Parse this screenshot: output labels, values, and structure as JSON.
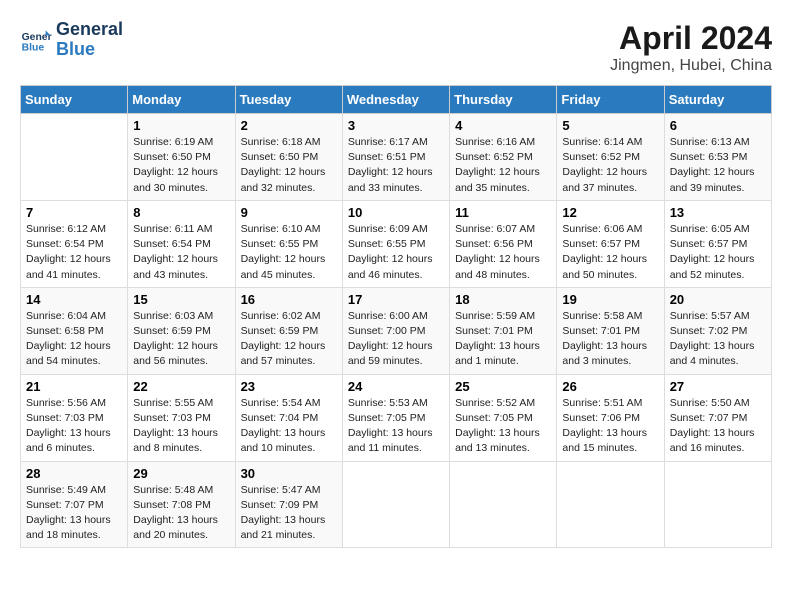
{
  "header": {
    "logo_line1": "General",
    "logo_line2": "Blue",
    "title": "April 2024",
    "subtitle": "Jingmen, Hubei, China"
  },
  "days_of_week": [
    "Sunday",
    "Monday",
    "Tuesday",
    "Wednesday",
    "Thursday",
    "Friday",
    "Saturday"
  ],
  "weeks": [
    [
      {
        "num": "",
        "info": ""
      },
      {
        "num": "1",
        "info": "Sunrise: 6:19 AM\nSunset: 6:50 PM\nDaylight: 12 hours\nand 30 minutes."
      },
      {
        "num": "2",
        "info": "Sunrise: 6:18 AM\nSunset: 6:50 PM\nDaylight: 12 hours\nand 32 minutes."
      },
      {
        "num": "3",
        "info": "Sunrise: 6:17 AM\nSunset: 6:51 PM\nDaylight: 12 hours\nand 33 minutes."
      },
      {
        "num": "4",
        "info": "Sunrise: 6:16 AM\nSunset: 6:52 PM\nDaylight: 12 hours\nand 35 minutes."
      },
      {
        "num": "5",
        "info": "Sunrise: 6:14 AM\nSunset: 6:52 PM\nDaylight: 12 hours\nand 37 minutes."
      },
      {
        "num": "6",
        "info": "Sunrise: 6:13 AM\nSunset: 6:53 PM\nDaylight: 12 hours\nand 39 minutes."
      }
    ],
    [
      {
        "num": "7",
        "info": "Sunrise: 6:12 AM\nSunset: 6:54 PM\nDaylight: 12 hours\nand 41 minutes."
      },
      {
        "num": "8",
        "info": "Sunrise: 6:11 AM\nSunset: 6:54 PM\nDaylight: 12 hours\nand 43 minutes."
      },
      {
        "num": "9",
        "info": "Sunrise: 6:10 AM\nSunset: 6:55 PM\nDaylight: 12 hours\nand 45 minutes."
      },
      {
        "num": "10",
        "info": "Sunrise: 6:09 AM\nSunset: 6:55 PM\nDaylight: 12 hours\nand 46 minutes."
      },
      {
        "num": "11",
        "info": "Sunrise: 6:07 AM\nSunset: 6:56 PM\nDaylight: 12 hours\nand 48 minutes."
      },
      {
        "num": "12",
        "info": "Sunrise: 6:06 AM\nSunset: 6:57 PM\nDaylight: 12 hours\nand 50 minutes."
      },
      {
        "num": "13",
        "info": "Sunrise: 6:05 AM\nSunset: 6:57 PM\nDaylight: 12 hours\nand 52 minutes."
      }
    ],
    [
      {
        "num": "14",
        "info": "Sunrise: 6:04 AM\nSunset: 6:58 PM\nDaylight: 12 hours\nand 54 minutes."
      },
      {
        "num": "15",
        "info": "Sunrise: 6:03 AM\nSunset: 6:59 PM\nDaylight: 12 hours\nand 56 minutes."
      },
      {
        "num": "16",
        "info": "Sunrise: 6:02 AM\nSunset: 6:59 PM\nDaylight: 12 hours\nand 57 minutes."
      },
      {
        "num": "17",
        "info": "Sunrise: 6:00 AM\nSunset: 7:00 PM\nDaylight: 12 hours\nand 59 minutes."
      },
      {
        "num": "18",
        "info": "Sunrise: 5:59 AM\nSunset: 7:01 PM\nDaylight: 13 hours\nand 1 minute."
      },
      {
        "num": "19",
        "info": "Sunrise: 5:58 AM\nSunset: 7:01 PM\nDaylight: 13 hours\nand 3 minutes."
      },
      {
        "num": "20",
        "info": "Sunrise: 5:57 AM\nSunset: 7:02 PM\nDaylight: 13 hours\nand 4 minutes."
      }
    ],
    [
      {
        "num": "21",
        "info": "Sunrise: 5:56 AM\nSunset: 7:03 PM\nDaylight: 13 hours\nand 6 minutes."
      },
      {
        "num": "22",
        "info": "Sunrise: 5:55 AM\nSunset: 7:03 PM\nDaylight: 13 hours\nand 8 minutes."
      },
      {
        "num": "23",
        "info": "Sunrise: 5:54 AM\nSunset: 7:04 PM\nDaylight: 13 hours\nand 10 minutes."
      },
      {
        "num": "24",
        "info": "Sunrise: 5:53 AM\nSunset: 7:05 PM\nDaylight: 13 hours\nand 11 minutes."
      },
      {
        "num": "25",
        "info": "Sunrise: 5:52 AM\nSunset: 7:05 PM\nDaylight: 13 hours\nand 13 minutes."
      },
      {
        "num": "26",
        "info": "Sunrise: 5:51 AM\nSunset: 7:06 PM\nDaylight: 13 hours\nand 15 minutes."
      },
      {
        "num": "27",
        "info": "Sunrise: 5:50 AM\nSunset: 7:07 PM\nDaylight: 13 hours\nand 16 minutes."
      }
    ],
    [
      {
        "num": "28",
        "info": "Sunrise: 5:49 AM\nSunset: 7:07 PM\nDaylight: 13 hours\nand 18 minutes."
      },
      {
        "num": "29",
        "info": "Sunrise: 5:48 AM\nSunset: 7:08 PM\nDaylight: 13 hours\nand 20 minutes."
      },
      {
        "num": "30",
        "info": "Sunrise: 5:47 AM\nSunset: 7:09 PM\nDaylight: 13 hours\nand 21 minutes."
      },
      {
        "num": "",
        "info": ""
      },
      {
        "num": "",
        "info": ""
      },
      {
        "num": "",
        "info": ""
      },
      {
        "num": "",
        "info": ""
      }
    ]
  ]
}
